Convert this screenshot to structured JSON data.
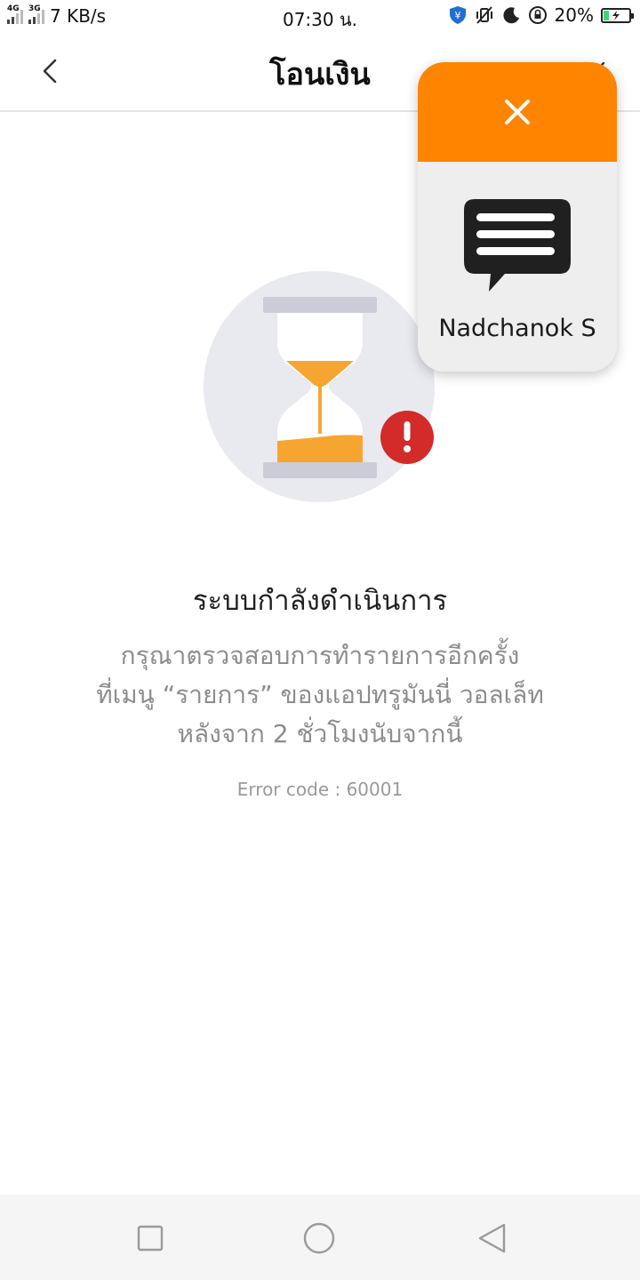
{
  "status_bar": {
    "net1": "4G",
    "net2": "3G",
    "speed": "7 KB/s",
    "time": "07:30 น.",
    "battery": "20%",
    "battery_level": 0.2
  },
  "header": {
    "title": "โอนเงิน"
  },
  "status": {
    "title": "ระบบกำลังดำเนินการ",
    "desc_line1": "กรุณาตรวจสอบการทำรายการอีกครั้ง",
    "desc_line2": "ที่เมนู “รายการ” ของแอปทรูมันนี่ วอลเล็ท",
    "desc_line3": "หลังจาก 2 ชั่วโมงนับจากนี้",
    "error_code": "Error code : 60001"
  },
  "bubble": {
    "contact_name": "Nadchanok S",
    "close_icon": "close-icon",
    "chat_icon": "chat-bubble-icon"
  },
  "colors": {
    "accent": "#ff8400",
    "sand": "#f7a531",
    "alert": "#d32a2a"
  }
}
